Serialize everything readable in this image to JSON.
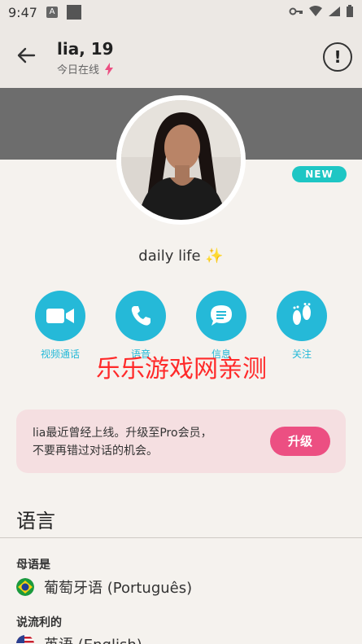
{
  "status_bar": {
    "time": "9:47",
    "app_badge": "A"
  },
  "header": {
    "name": "lia, 19",
    "online_status": "今日在线",
    "back_icon": "arrow-left-icon",
    "report_icon": "alert-icon"
  },
  "profile": {
    "new_badge": "NEW",
    "bio": "daily life ✨"
  },
  "actions": [
    {
      "label": "视频通话",
      "icon": "video-camera-icon"
    },
    {
      "label": "语音",
      "icon": "phone-icon"
    },
    {
      "label": "信息",
      "icon": "chat-bubble-icon"
    },
    {
      "label": "关注",
      "icon": "footprints-icon"
    }
  ],
  "watermark": "乐乐游戏网亲测",
  "upgrade": {
    "text_line1": "lia最近曾经上线。升级至Pro会员，",
    "text_line2": "不要再错过对话的机会。",
    "button": "升级"
  },
  "languages": {
    "title": "语言",
    "native_heading": "母语是",
    "native": {
      "label": "葡萄牙语 (Português)",
      "flag": "brazil-flag-icon"
    },
    "fluent_heading": "说流利的",
    "fluent": {
      "label": "英语 (English)",
      "flag": "usa-flag-icon"
    }
  },
  "colors": {
    "accent": "#25b9d8",
    "new_badge": "#1ec6c4",
    "upgrade_button": "#ec4f82",
    "upgrade_card": "#f5dfe1",
    "cover": "#6d6d6d"
  }
}
